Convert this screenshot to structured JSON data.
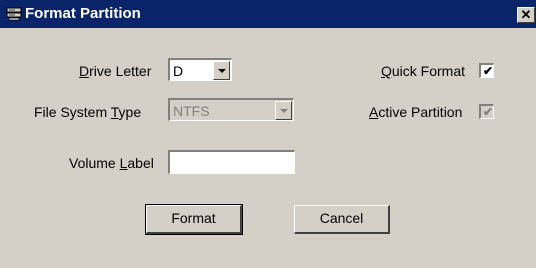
{
  "window": {
    "title": "Format Partition",
    "close_glyph": "✕",
    "title_icon": "format-partition-icon"
  },
  "form": {
    "drive_letter": {
      "label_pre": "",
      "label_ul": "D",
      "label_post": "rive Letter",
      "value": "D"
    },
    "file_system_type": {
      "label_pre": "File System ",
      "label_ul": "T",
      "label_post": "ype",
      "value": "NTFS",
      "enabled": false
    },
    "volume_label": {
      "label_pre": "Volume ",
      "label_ul": "L",
      "label_post": "abel",
      "value": ""
    },
    "quick_format": {
      "label_pre": "",
      "label_ul": "Q",
      "label_post": "uick Format",
      "checked": true,
      "glyph": "✔"
    },
    "active_partition": {
      "label_pre": "",
      "label_ul": "A",
      "label_post": "ctive Partition",
      "checked": true,
      "enabled": false,
      "glyph": "✔"
    }
  },
  "buttons": {
    "format": "Format",
    "cancel": "Cancel"
  },
  "colors": {
    "titlebar": "#0a246a",
    "face": "#d4d0c8"
  }
}
